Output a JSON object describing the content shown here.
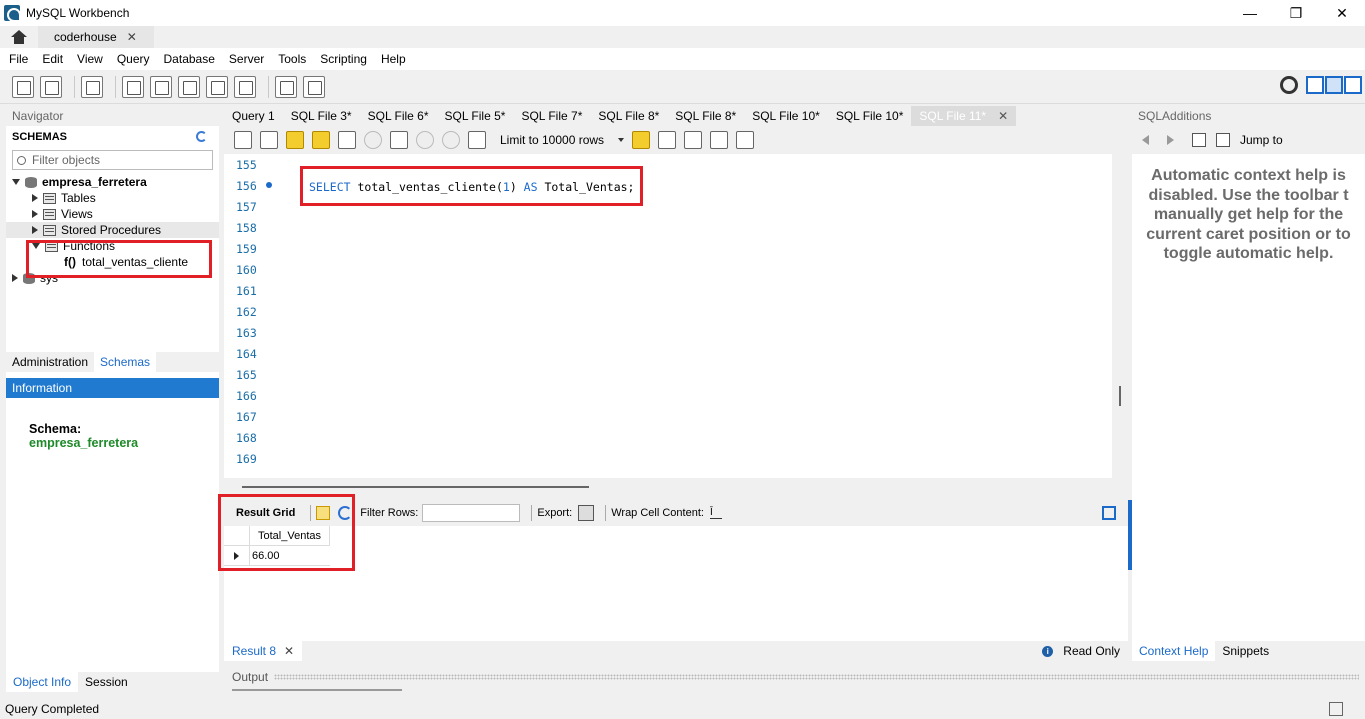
{
  "window": {
    "title": "MySQL Workbench"
  },
  "connection_tab": {
    "label": "coderhouse"
  },
  "menu": [
    "File",
    "Edit",
    "View",
    "Query",
    "Database",
    "Server",
    "Tools",
    "Scripting",
    "Help"
  ],
  "navigator": {
    "header": "Navigator",
    "schemas_label": "SCHEMAS",
    "filter_placeholder": "Filter objects",
    "tree": {
      "schema": "empresa_ferretera",
      "tables": "Tables",
      "views": "Views",
      "procedures": "Stored Procedures",
      "functions": "Functions",
      "fn_prefix": "f()",
      "fn_name": "total_ventas_cliente",
      "sys": "sys"
    },
    "tabs": [
      "Administration",
      "Schemas"
    ],
    "info_header": "Information",
    "info_schema_label": "Schema:",
    "info_schema_name": "empresa_ferretera",
    "bottom_tabs": [
      "Object Info",
      "Session"
    ]
  },
  "editor": {
    "tabs": [
      "Query 1",
      "SQL File 3*",
      "SQL File 6*",
      "SQL File 5*",
      "SQL File 7*",
      "SQL File 8*",
      "SQL File 8*",
      "SQL File 10*",
      "SQL File 10*",
      "SQL File 11*"
    ],
    "limit": "Limit to 10000 rows",
    "line_numbers": [
      "155",
      "156",
      "157",
      "158",
      "159",
      "160",
      "161",
      "162",
      "163",
      "164",
      "165",
      "166",
      "167",
      "168",
      "169"
    ],
    "code": {
      "kw1": "SELECT",
      "fn": " total_ventas_cliente(",
      "arg": "1",
      "close": ") ",
      "kw2": "AS",
      "alias": " Total_Ventas;"
    }
  },
  "result": {
    "grid_label": "Result Grid",
    "filter_label": "Filter Rows:",
    "export_label": "Export:",
    "wrap_label": "Wrap Cell Content:",
    "columns": [
      "Total_Ventas"
    ],
    "rows": [
      [
        "66.00"
      ]
    ],
    "tab": "Result 8",
    "readonly": "Read Only"
  },
  "output": {
    "label": "Output"
  },
  "additions": {
    "header": "SQLAdditions",
    "jump": "Jump to",
    "help_lines": [
      "Automatic context help is",
      "disabled. Use the toolbar t",
      "manually get help for the",
      "current caret position or to",
      "toggle automatic help."
    ],
    "tabs": [
      "Context Help",
      "Snippets"
    ]
  },
  "status": {
    "text": "Query Completed"
  },
  "colors": {
    "accent": "#1f7ad0",
    "highlight": "#e11f26",
    "schema_green": "#1e8a2a"
  }
}
